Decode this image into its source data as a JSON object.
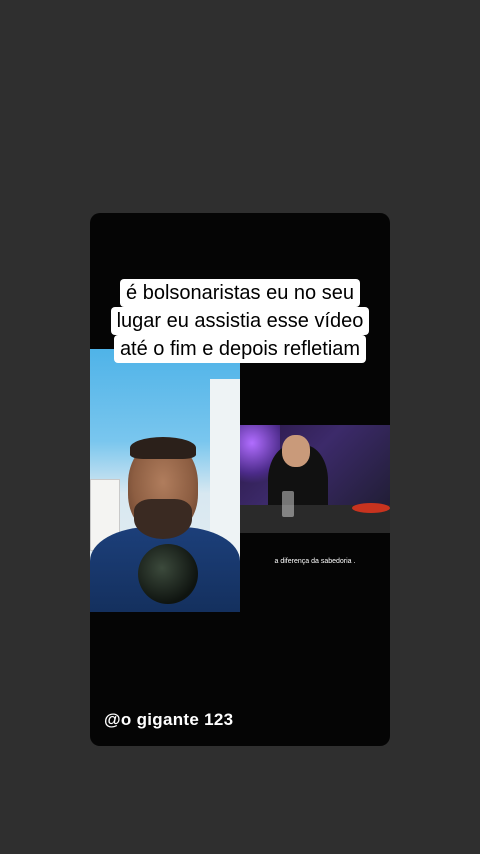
{
  "caption": {
    "lines": [
      "é bolsonaristas eu no seu",
      "lugar eu assistia esse vídeo",
      "até o fim e depois refletiam"
    ]
  },
  "subtitle": "a diferença da sabedoria .",
  "watermark": "@o gigante 123",
  "colors": {
    "background": "#2f2f2f",
    "card": "#050505",
    "caption_bg": "#ffffff"
  }
}
